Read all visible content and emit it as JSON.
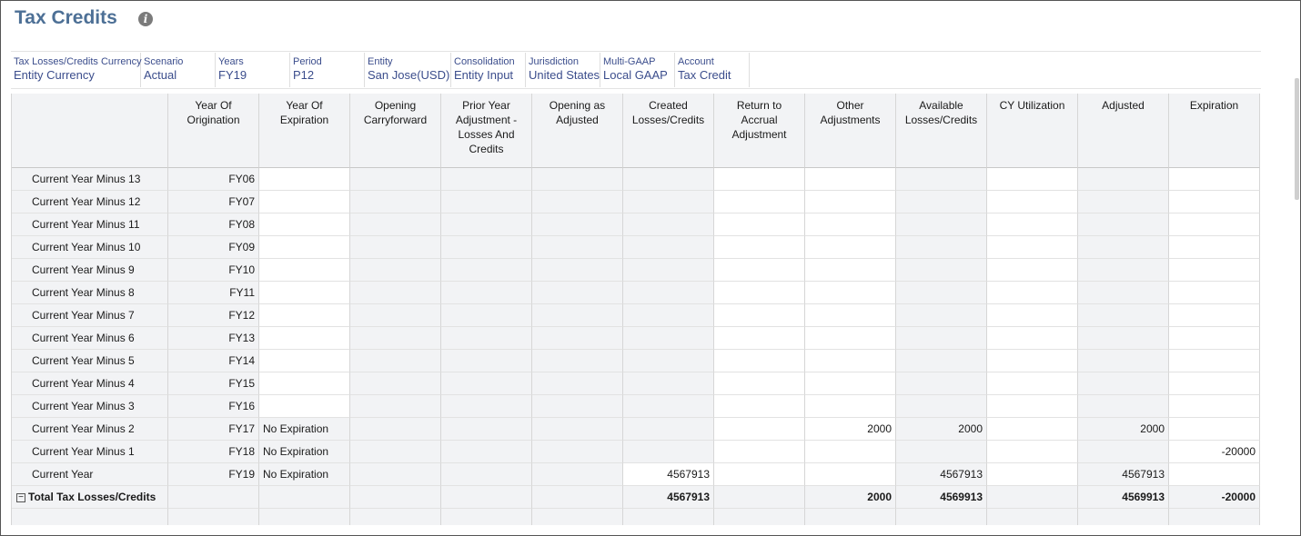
{
  "title": "Tax Credits",
  "info_icon": "info-icon",
  "pov": [
    {
      "label": "Tax Losses/Credits Currency",
      "value": "Entity Currency"
    },
    {
      "label": "Scenario",
      "value": "Actual"
    },
    {
      "label": "Years",
      "value": "FY19"
    },
    {
      "label": "Period",
      "value": "P12"
    },
    {
      "label": "Entity",
      "value": "San Jose(USD)"
    },
    {
      "label": "Consolidation",
      "value": "Entity Input"
    },
    {
      "label": "Jurisdiction",
      "value": "United States"
    },
    {
      "label": "Multi-GAAP",
      "value": "Local GAAP"
    },
    {
      "label": "Account",
      "value": "Tax Credit"
    }
  ],
  "columns": [
    "",
    "Year Of Origination",
    "Year Of Expiration",
    "Opening Carryforward",
    "Prior Year Adjustment - Losses And Credits",
    "Opening as Adjusted",
    "Created Losses/Credits",
    "Return to Accrual Adjustment",
    "Other Adjustments",
    "Available Losses/Credits",
    "CY Utilization",
    "Adjusted",
    "Expiration"
  ],
  "rows": [
    [
      "Current Year Minus 13",
      "FY06",
      "",
      "",
      "",
      "",
      "",
      "",
      "",
      "",
      "",
      "",
      ""
    ],
    [
      "Current Year Minus 12",
      "FY07",
      "",
      "",
      "",
      "",
      "",
      "",
      "",
      "",
      "",
      "",
      ""
    ],
    [
      "Current Year Minus 11",
      "FY08",
      "",
      "",
      "",
      "",
      "",
      "",
      "",
      "",
      "",
      "",
      ""
    ],
    [
      "Current Year Minus 10",
      "FY09",
      "",
      "",
      "",
      "",
      "",
      "",
      "",
      "",
      "",
      "",
      ""
    ],
    [
      "Current Year Minus 9",
      "FY10",
      "",
      "",
      "",
      "",
      "",
      "",
      "",
      "",
      "",
      "",
      ""
    ],
    [
      "Current Year Minus 8",
      "FY11",
      "",
      "",
      "",
      "",
      "",
      "",
      "",
      "",
      "",
      "",
      ""
    ],
    [
      "Current Year Minus 7",
      "FY12",
      "",
      "",
      "",
      "",
      "",
      "",
      "",
      "",
      "",
      "",
      ""
    ],
    [
      "Current Year Minus 6",
      "FY13",
      "",
      "",
      "",
      "",
      "",
      "",
      "",
      "",
      "",
      "",
      ""
    ],
    [
      "Current Year Minus 5",
      "FY14",
      "",
      "",
      "",
      "",
      "",
      "",
      "",
      "",
      "",
      "",
      ""
    ],
    [
      "Current Year Minus 4",
      "FY15",
      "",
      "",
      "",
      "",
      "",
      "",
      "",
      "",
      "",
      "",
      ""
    ],
    [
      "Current Year Minus 3",
      "FY16",
      "",
      "",
      "",
      "",
      "",
      "",
      "",
      "",
      "",
      "",
      ""
    ],
    [
      "Current Year Minus 2",
      "FY17",
      "No Expiration",
      "",
      "",
      "",
      "",
      "",
      "2000",
      "2000",
      "",
      "2000",
      ""
    ],
    [
      "Current Year Minus 1",
      "FY18",
      "No Expiration",
      "",
      "",
      "",
      "",
      "",
      "",
      "",
      "",
      "",
      "-20000"
    ],
    [
      "Current Year",
      "FY19",
      "No Expiration",
      "",
      "",
      "",
      "4567913",
      "",
      "",
      "4567913",
      "",
      "4567913",
      ""
    ]
  ],
  "total_row": [
    "Total Tax Losses/Credits",
    "",
    "",
    "",
    "",
    "",
    "4567913",
    "",
    "2000",
    "4569913",
    "",
    "4569913",
    "-20000"
  ],
  "total_toggle": "⊟",
  "colors": {
    "title": "#4d7096",
    "pov_text": "#3b4d8c",
    "readonly_cell": "#f2f3f5"
  }
}
